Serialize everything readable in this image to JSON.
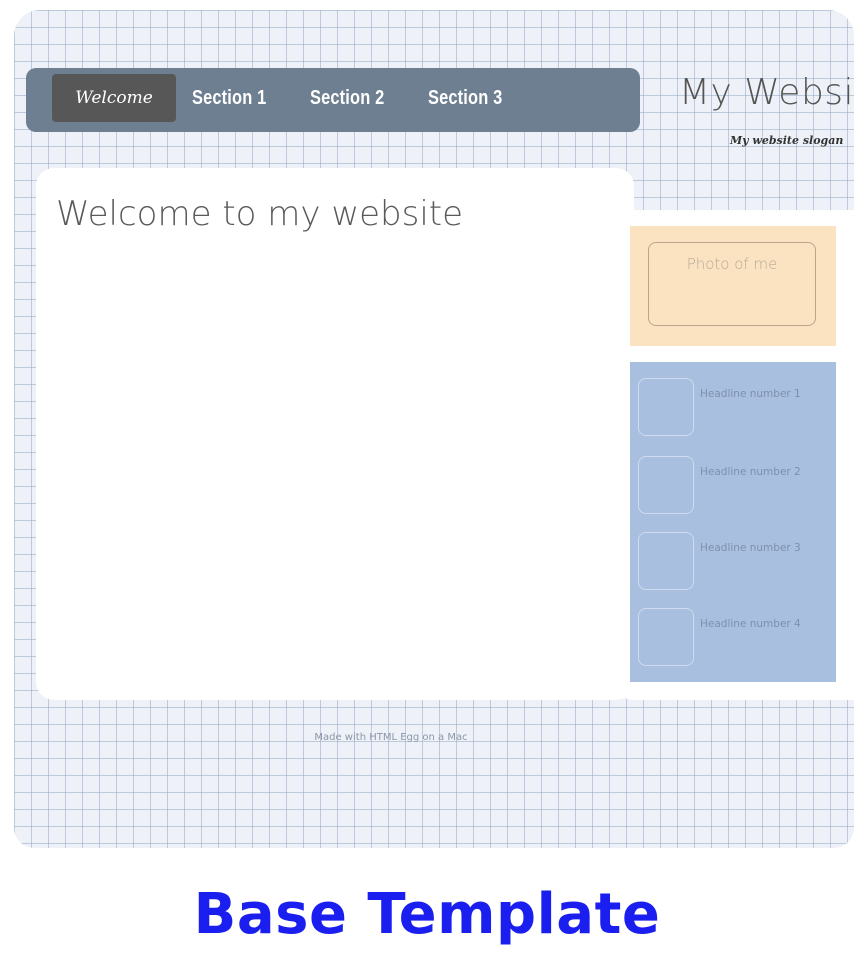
{
  "nav": {
    "welcome_label": "Welcome",
    "section1_label": "Section 1",
    "section2_label": "Section 2",
    "section3_label": "Section 3"
  },
  "site": {
    "title": "My Websit",
    "slogan": "My website slogan"
  },
  "main": {
    "heading": "Welcome to my website"
  },
  "sidebar": {
    "photo_label": "Photo of me",
    "headlines": [
      {
        "label": "Headline number 1"
      },
      {
        "label": "Headline number 2"
      },
      {
        "label": "Headline number 3"
      },
      {
        "label": "Headline number 4"
      }
    ]
  },
  "footer": {
    "text": "Made with HTML Egg on a Mac"
  },
  "caption": "Base Template",
  "colors": {
    "nav_bar": "#6e7f92",
    "nav_active": "#575757",
    "photo_panel": "#fbe3c2",
    "headline_panel": "#a9bfdf",
    "caption_text": "#1a1ff0"
  }
}
